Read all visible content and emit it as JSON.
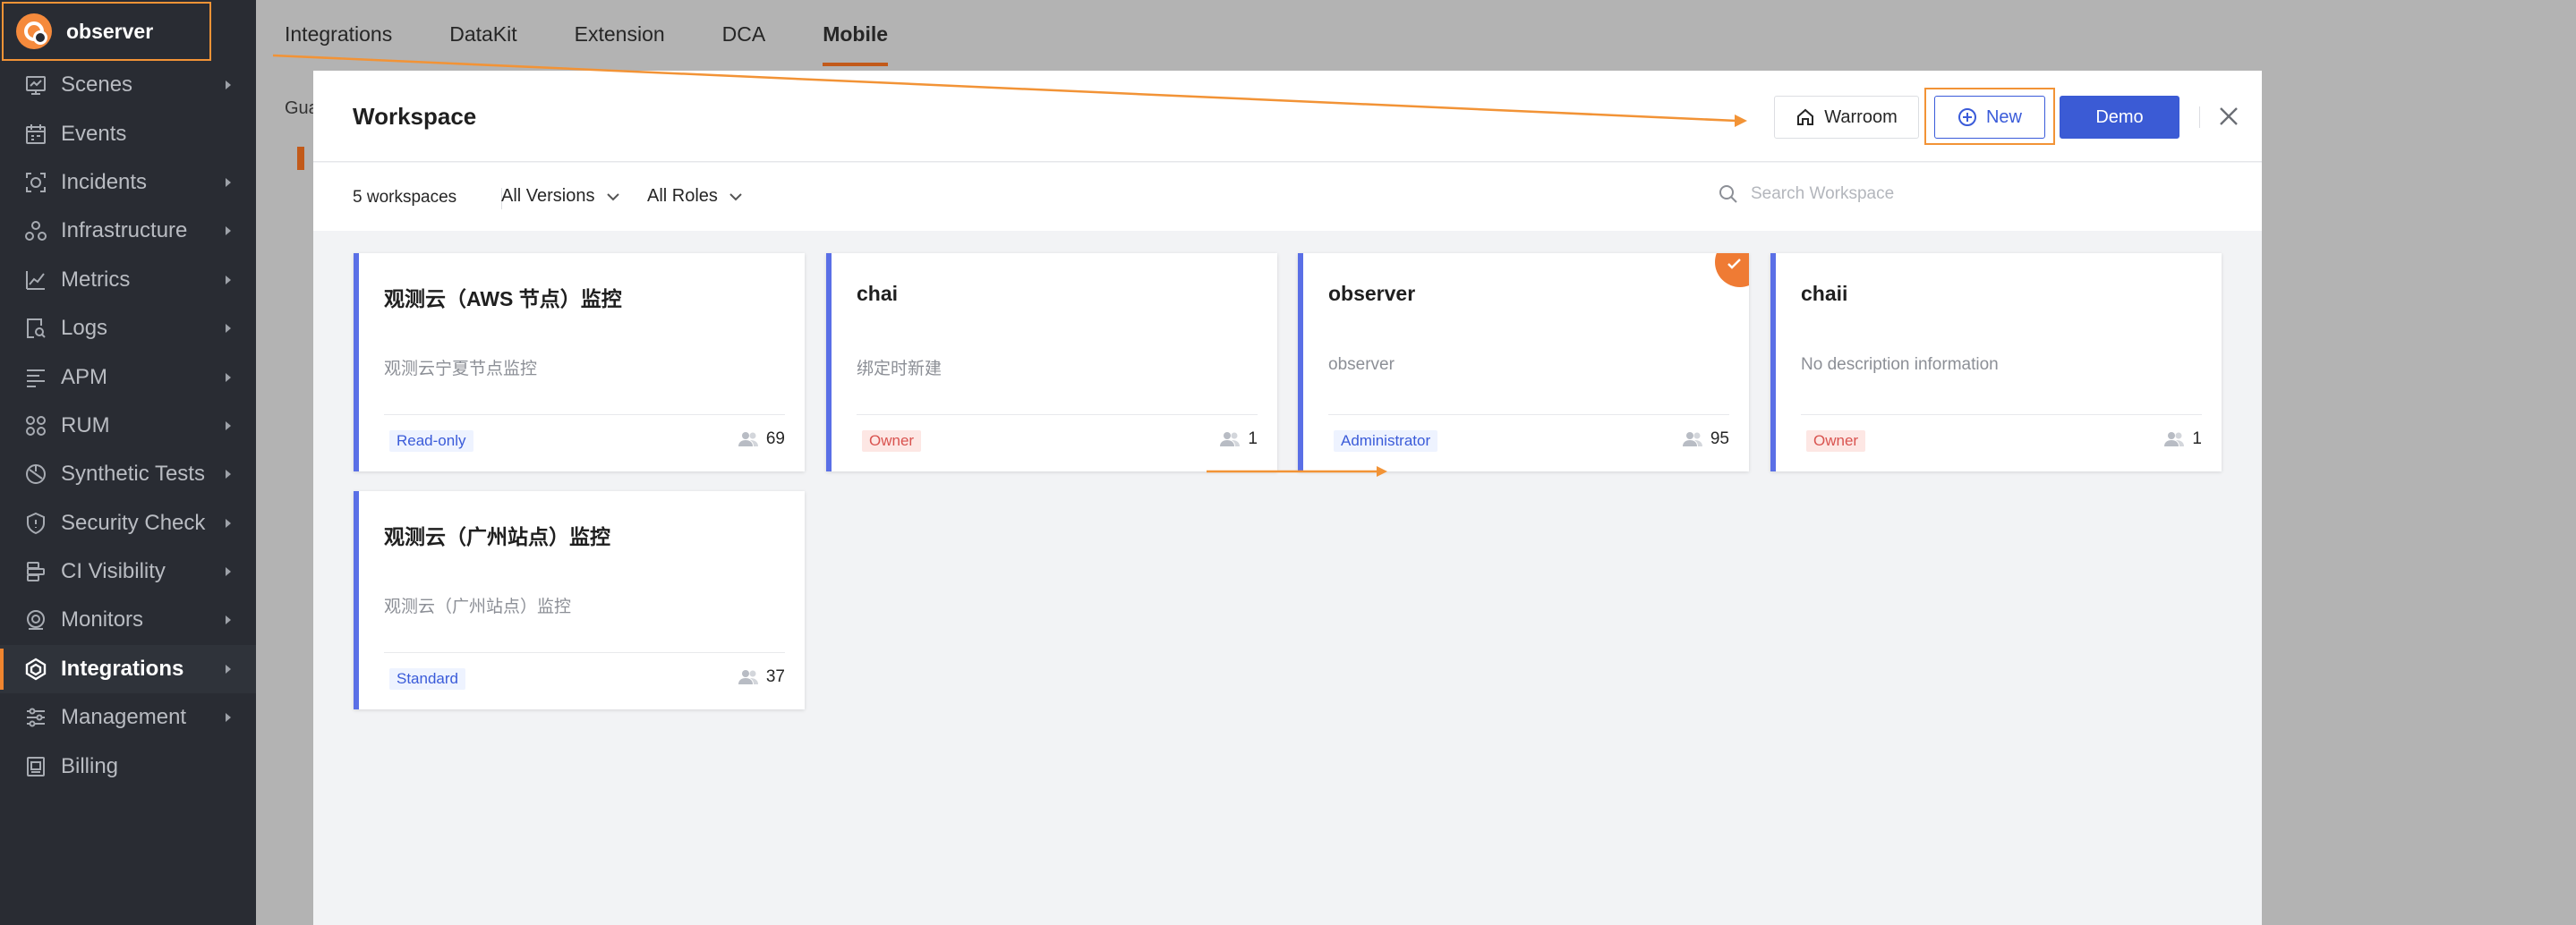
{
  "colors": {
    "accent": "#f29336",
    "primary": "#3b5bd5",
    "sidebar_bg": "#292c33",
    "card_border": "#5a6fe6"
  },
  "brand": {
    "name": "observer",
    "icon": "observer-logo-icon"
  },
  "sidebar": {
    "items": [
      {
        "label": "Scenes",
        "icon": "scenes-icon",
        "has_arrow": true
      },
      {
        "label": "Events",
        "icon": "events-icon",
        "has_arrow": false
      },
      {
        "label": "Incidents",
        "icon": "incidents-icon",
        "has_arrow": true
      },
      {
        "label": "Infrastructure",
        "icon": "infrastructure-icon",
        "has_arrow": true
      },
      {
        "label": "Metrics",
        "icon": "metrics-icon",
        "has_arrow": true
      },
      {
        "label": "Logs",
        "icon": "logs-icon",
        "has_arrow": true
      },
      {
        "label": "APM",
        "icon": "apm-icon",
        "has_arrow": true
      },
      {
        "label": "RUM",
        "icon": "rum-icon",
        "has_arrow": true
      },
      {
        "label": "Synthetic Tests",
        "icon": "synthetic-tests-icon",
        "has_arrow": true
      },
      {
        "label": "Security Check",
        "icon": "security-check-icon",
        "has_arrow": true
      },
      {
        "label": "CI Visibility",
        "icon": "ci-visibility-icon",
        "has_arrow": true
      },
      {
        "label": "Monitors",
        "icon": "monitors-icon",
        "has_arrow": true
      },
      {
        "label": "Integrations",
        "icon": "integrations-icon",
        "has_arrow": true,
        "active": true
      },
      {
        "label": "Management",
        "icon": "management-icon",
        "has_arrow": true
      },
      {
        "label": "Billing",
        "icon": "billing-icon",
        "has_arrow": false
      }
    ]
  },
  "topnav": {
    "tabs": [
      {
        "label": "Integrations"
      },
      {
        "label": "DataKit"
      },
      {
        "label": "Extension"
      },
      {
        "label": "DCA"
      },
      {
        "label": "Mobile",
        "active": true
      }
    ]
  },
  "background": {
    "partial_label": "Gua"
  },
  "modal": {
    "title": "Workspace",
    "warroom_label": "Warroom",
    "new_label": "New",
    "demo_label": "Demo",
    "workspace_count": "5 workspaces",
    "versions_filter": "All Versions",
    "roles_filter": "All Roles",
    "search_placeholder": "Search Workspace"
  },
  "workspaces": [
    {
      "name": "观测云（AWS 节点）监控",
      "description": "观测云宁夏节点监控",
      "role": "Read-only",
      "role_color": "blue",
      "members": "69",
      "current": false
    },
    {
      "name": "chai",
      "description": "绑定时新建",
      "role": "Owner",
      "role_color": "red",
      "members": "1",
      "current": false
    },
    {
      "name": "observer",
      "description": "observer",
      "role": "Administrator",
      "role_color": "blue",
      "members": "95",
      "current": true
    },
    {
      "name": "chaii",
      "description": "No description information",
      "role": "Owner",
      "role_color": "red",
      "members": "1",
      "current": false
    },
    {
      "name": "观测云（广州站点）监控",
      "description": "观测云（广州站点）监控",
      "role": "Standard",
      "role_color": "blue",
      "members": "37",
      "current": false
    }
  ]
}
